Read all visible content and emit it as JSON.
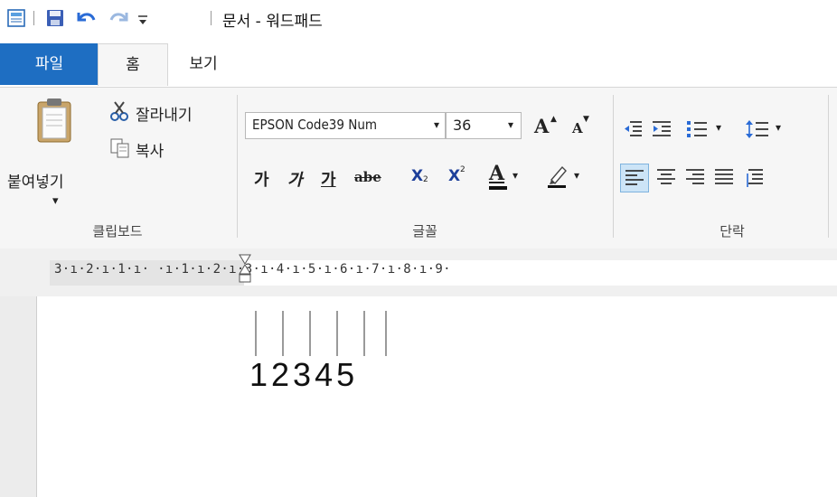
{
  "window": {
    "title": "문서 - 워드패드"
  },
  "tabs": {
    "file": "파일",
    "home": "홈",
    "view": "보기"
  },
  "clipboard": {
    "paste_label": "붙여넣기",
    "paste_arrow": "▾",
    "cut_label": "잘라내기",
    "copy_label": "복사",
    "group_label": "클립보드"
  },
  "font": {
    "family": "EPSON Code39 Num",
    "size": "36",
    "dropdown_arrow": "▾",
    "grow": "A",
    "shrink": "A",
    "bold": "가",
    "italic": "가",
    "underline": "가",
    "strikethrough": "abe",
    "subscript_x": "X",
    "subscript_mark": "2",
    "superscript_x": "X",
    "superscript_mark": "2",
    "text_color": "A",
    "group_label": "글꼴"
  },
  "paragraph": {
    "group_label": "단락",
    "list_arrow": "▾",
    "spacing_arrow": "▾"
  },
  "ruler": {
    "text": "3·ı·2·ı·1·ı·  ·ı·1·ı·2·ı·3·ı·4·ı·5·ı·6·ı·7·ı·8·ı·9·"
  },
  "document": {
    "barcode_text": "12345"
  },
  "colors": {
    "file_tab": "#1e6ec2",
    "ribbon_bg": "#f6f6f6",
    "highlight": "#cce4f7"
  }
}
